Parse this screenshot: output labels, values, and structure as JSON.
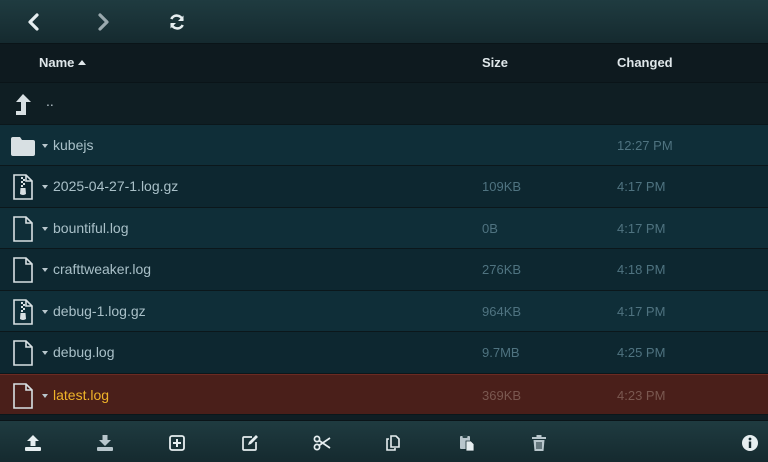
{
  "toolbar": {
    "icons": [
      "chevron-left-icon",
      "chevron-right-icon",
      "refresh-icon"
    ]
  },
  "columns": {
    "name": "Name",
    "size": "Size",
    "changed": "Changed"
  },
  "parent_row": {
    "label": ".."
  },
  "files": [
    {
      "name": "kubejs",
      "type": "folder",
      "size": "",
      "changed": "12:27 PM"
    },
    {
      "name": "2025-04-27-1.log.gz",
      "type": "archive",
      "size": "109KB",
      "changed": "4:17 PM"
    },
    {
      "name": "bountiful.log",
      "type": "file",
      "size": "0B",
      "changed": "4:17 PM"
    },
    {
      "name": "crafttweaker.log",
      "type": "file",
      "size": "276KB",
      "changed": "4:18 PM"
    },
    {
      "name": "debug-1.log.gz",
      "type": "archive",
      "size": "964KB",
      "changed": "4:17 PM"
    },
    {
      "name": "debug.log",
      "type": "file",
      "size": "9.7MB",
      "changed": "4:25 PM"
    },
    {
      "name": "latest.log",
      "type": "file",
      "size": "369KB",
      "changed": "4:23 PM",
      "selected": true
    }
  ],
  "bottombar": {
    "icons": [
      "upload-icon",
      "download-icon",
      "new-item-icon",
      "rename-icon",
      "cut-icon",
      "copy-icon",
      "paste-icon",
      "delete-icon",
      "info-icon"
    ]
  },
  "colors": {
    "selected_row": "#4a1f1a",
    "selected_text": "#f0b429",
    "row_even": "#0f2e38",
    "row_odd": "#0d2730"
  }
}
